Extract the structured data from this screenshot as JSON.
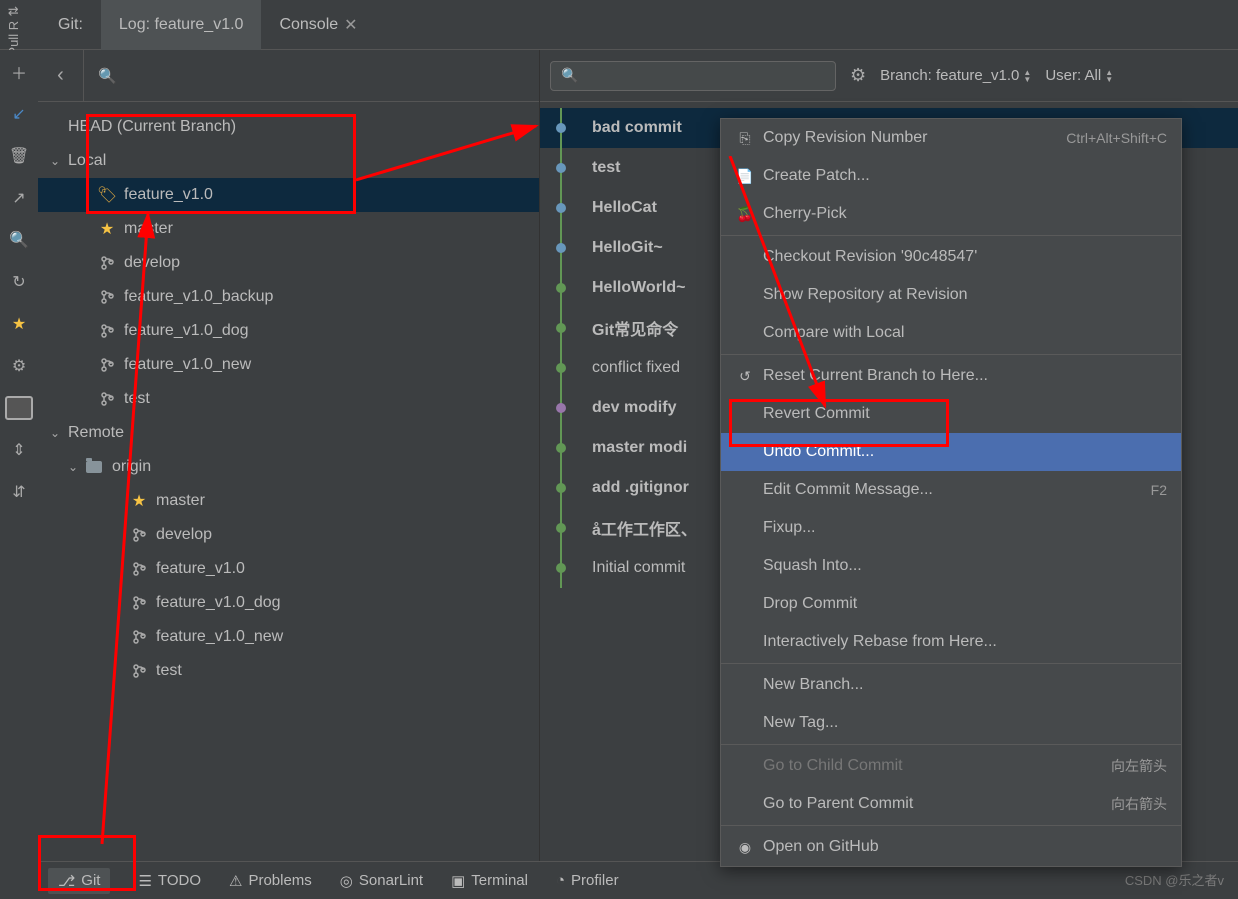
{
  "topbar": {
    "git_label": "Git:",
    "log_label": "Log: feature_v1.0",
    "console_label": "Console"
  },
  "side": {
    "pull": "Pull R",
    "structure": "Structure",
    "favorites": "Favorites"
  },
  "filters": {
    "branch": "Branch: feature_v1.0",
    "user": "User: All"
  },
  "tree": {
    "head": "HEAD (Current Branch)",
    "local": "Local",
    "remote": "Remote",
    "origin": "origin",
    "local_branches": [
      "feature_v1.0",
      "master",
      "develop",
      "feature_v1.0_backup",
      "feature_v1.0_dog",
      "feature_v1.0_new",
      "test"
    ],
    "remote_branches": [
      "master",
      "develop",
      "feature_v1.0",
      "feature_v1.0_dog",
      "feature_v1.0_new",
      "test"
    ]
  },
  "commits": [
    {
      "msg": "bad commit",
      "sel": true,
      "bold": true,
      "color": "b"
    },
    {
      "msg": "test",
      "bold": true,
      "color": "b"
    },
    {
      "msg": "HelloCat",
      "bold": true,
      "color": "b"
    },
    {
      "msg": "HelloGit~",
      "bold": true,
      "color": "b"
    },
    {
      "msg": "HelloWorld~",
      "bold": true,
      "color": "g"
    },
    {
      "msg": "Git常见命令",
      "bold": true,
      "color": "g"
    },
    {
      "msg": "conflict fixed",
      "color": "g"
    },
    {
      "msg": "dev modify",
      "bold": true,
      "color": "p"
    },
    {
      "msg": "master modi",
      "bold": true,
      "color": "g"
    },
    {
      "msg": "add .gitignor",
      "bold": true,
      "color": "g"
    },
    {
      "msg": "å工作工作区、",
      "bold": true,
      "color": "g"
    },
    {
      "msg": "Initial commit",
      "color": "g"
    }
  ],
  "ctx": {
    "copy_revision": "Copy Revision Number",
    "copy_revision_sc": "Ctrl+Alt+Shift+C",
    "create_patch": "Create Patch...",
    "cherry_pick": "Cherry-Pick",
    "checkout": "Checkout Revision '90c48547'",
    "show_repo": "Show Repository at Revision",
    "compare": "Compare with Local",
    "reset": "Reset Current Branch to Here...",
    "revert": "Revert Commit",
    "undo": "Undo Commit...",
    "edit_msg": "Edit Commit Message...",
    "edit_msg_sc": "F2",
    "fixup": "Fixup...",
    "squash": "Squash Into...",
    "drop": "Drop Commit",
    "rebase": "Interactively Rebase from Here...",
    "new_branch": "New Branch...",
    "new_tag": "New Tag...",
    "child": "Go to Child Commit",
    "child_sc": "向左箭头",
    "parent": "Go to Parent Commit",
    "parent_sc": "向右箭头",
    "github": "Open on GitHub"
  },
  "bottom": {
    "git": "Git",
    "todo": "TODO",
    "problems": "Problems",
    "sonar": "SonarLint",
    "terminal": "Terminal",
    "profiler": "Profiler"
  },
  "watermark": "CSDN @乐之者v"
}
